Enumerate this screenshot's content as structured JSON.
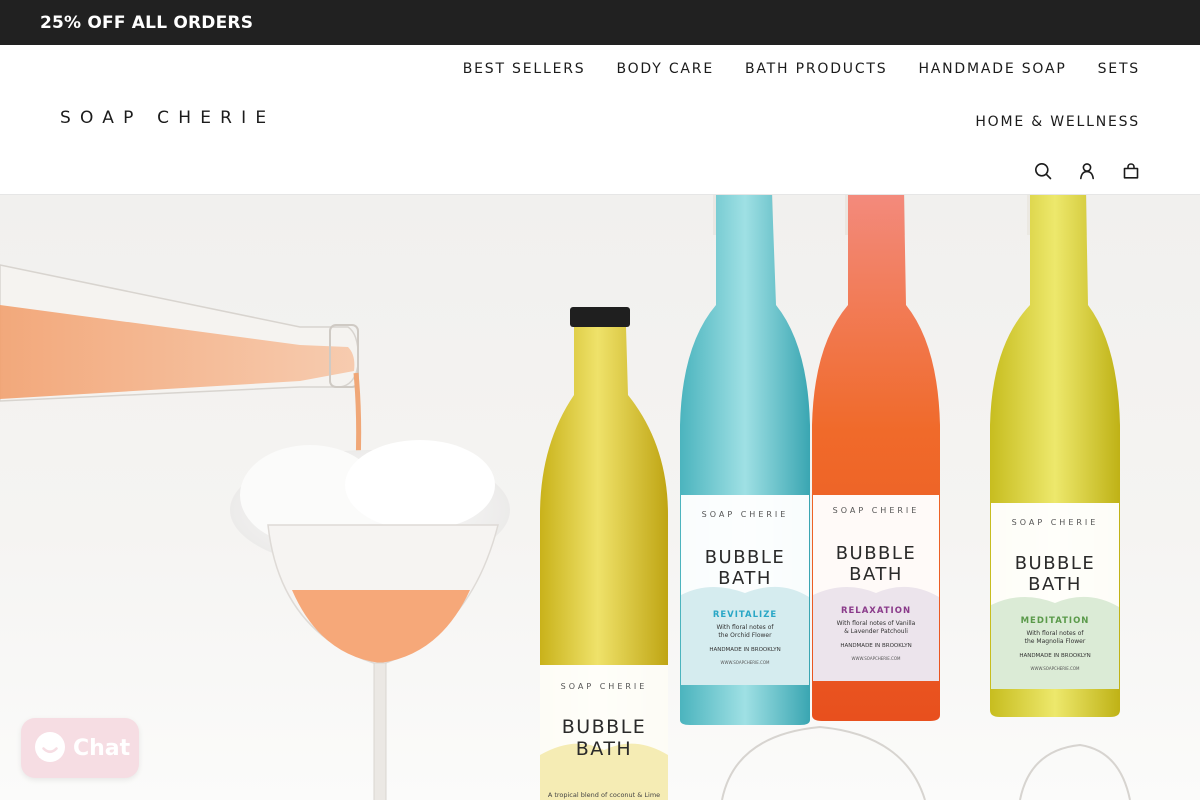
{
  "announcement": {
    "text": "25% OFF ALL ORDERS"
  },
  "brand": {
    "logo": "SOAP CHERIE"
  },
  "nav": {
    "items": [
      {
        "label": "BEST SELLERS"
      },
      {
        "label": "BODY CARE"
      },
      {
        "label": "BATH PRODUCTS"
      },
      {
        "label": "HANDMADE SOAP"
      },
      {
        "label": "SETS"
      },
      {
        "label": "HOME & WELLNESS"
      }
    ]
  },
  "header_icons": [
    "search-icon",
    "account-icon",
    "cart-icon"
  ],
  "hero": {
    "products": [
      {
        "brand": "SOAP CHERIE",
        "title1": "BUBBLE",
        "title2": "BATH",
        "variant": "",
        "note1": "A tropical blend of coconut & Lime",
        "note2": "",
        "made": "",
        "url": ""
      },
      {
        "brand": "SOAP CHERIE",
        "title1": "BUBBLE",
        "title2": "BATH",
        "variant": "REVITALIZE",
        "note1": "With floral notes of",
        "note2": "the Orchid Flower",
        "made": "HANDMADE IN BROOKLYN",
        "url": "WWW.SOAPCHERIE.COM"
      },
      {
        "brand": "SOAP CHERIE",
        "title1": "BUBBLE",
        "title2": "BATH",
        "variant": "RELAXATION",
        "note1": "With floral notes of Vanilla",
        "note2": "& Lavender Patchouli",
        "made": "HANDMADE IN BROOKLYN",
        "url": "WWW.SOAPCHERIE.COM"
      },
      {
        "brand": "SOAP CHERIE",
        "title1": "BUBBLE",
        "title2": "BATH",
        "variant": "MEDITATION",
        "note1": "With floral notes of",
        "note2": "the Magnolia Flower",
        "made": "HANDMADE IN BROOKLYN",
        "url": "WWW.SOAPCHERIE.COM"
      }
    ]
  },
  "chat": {
    "label": "Chat"
  },
  "colors": {
    "announcement_bg": "#212121",
    "chat_bg": "#f6dde3",
    "revitalize": "#2aa7c6",
    "relaxation": "#8a3a8a",
    "meditation": "#5a9a4a"
  }
}
